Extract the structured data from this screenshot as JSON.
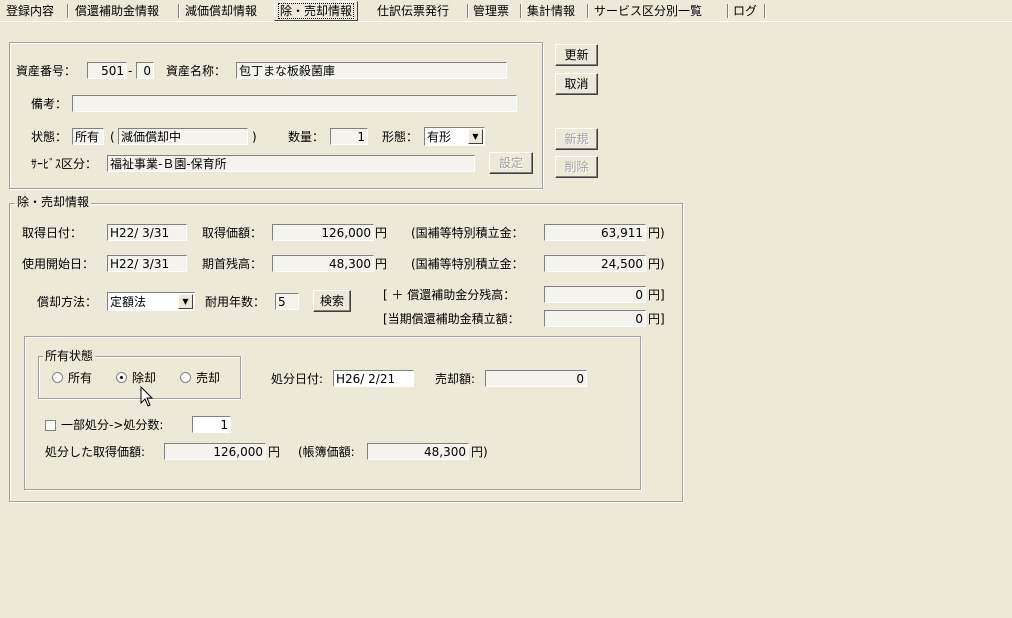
{
  "tabs": [
    {
      "label": "登録内容"
    },
    {
      "label": "償還補助金情報"
    },
    {
      "label": "減価償却情報"
    },
    {
      "label": "除・売却情報"
    },
    {
      "label": "仕訳伝票発行"
    },
    {
      "label": "管理票"
    },
    {
      "label": "集計情報"
    },
    {
      "label": "サービス区分別一覧"
    },
    {
      "label": "ログ"
    }
  ],
  "header": {
    "asset_number_label": "資産番号：",
    "asset_number": "501",
    "asset_sep": "-",
    "asset_sub": "0",
    "asset_name_label": "資産名称：",
    "asset_name": "包丁まな板殺菌庫",
    "remarks_label": "備考：",
    "remarks": "",
    "status_label": "状態：",
    "status_value": "所有",
    "status_paren_open": "(",
    "status_detail": "減価償却中",
    "status_paren_close": ")",
    "quantity_label": "数量：",
    "quantity": "1",
    "form_label": "形態：",
    "form_value": "有形",
    "service_label": "ｻｰﾋﾞｽ区分：",
    "service_value": "福祉事業-Ｂ園-保育所",
    "settings_button": "設定"
  },
  "buttons": {
    "update": "更新",
    "cancel": "取消",
    "new": "新規",
    "delete": "削除"
  },
  "disposal": {
    "legend": "除・売却情報",
    "acq_date_label": "取得日付：",
    "acq_date": "H22/ 3/31",
    "acq_price_label": "取得価額：",
    "acq_price": "126,000",
    "yen": "円",
    "subsidy1_label": "(国補等特別積立金：",
    "subsidy1": "63,911",
    "subsidy1_close": "円)",
    "start_date_label": "使用開始日：",
    "start_date": "H22/ 3/31",
    "opening_balance_label": "期首残高：",
    "opening_balance": "48,300",
    "subsidy2_label": "(国補等特別積立金：",
    "subsidy2": "24,500",
    "subsidy2_close": "円)",
    "method_label": "償却方法：",
    "method_value": "定額法",
    "life_label": "耐用年数：",
    "life_value": "5",
    "search_button": "検索",
    "redemption_label": "[ ＋ 償還補助金分残高：",
    "redemption_value": "0",
    "redemption_close": "円]",
    "current_label": "[当期償還補助金積立額：",
    "current_value": "0",
    "current_close": "円]"
  },
  "ownership": {
    "legend": "所有状態",
    "options": [
      {
        "label": "所有",
        "selected": false
      },
      {
        "label": "除却",
        "selected": true
      },
      {
        "label": "売却",
        "selected": false
      }
    ],
    "disposal_date_label": "処分日付:",
    "disposal_date": "H26/ 2/21",
    "sale_amount_label": "売却額:",
    "sale_amount": "0",
    "partial_label": "一部処分->処分数:",
    "partial_count": "1",
    "disposed_acq_label": "処分した取得価額:",
    "disposed_acq": "126,000",
    "yen": "円",
    "book_value_label": "(帳簿価額:",
    "book_value": "48,300",
    "book_value_close": "円)"
  }
}
